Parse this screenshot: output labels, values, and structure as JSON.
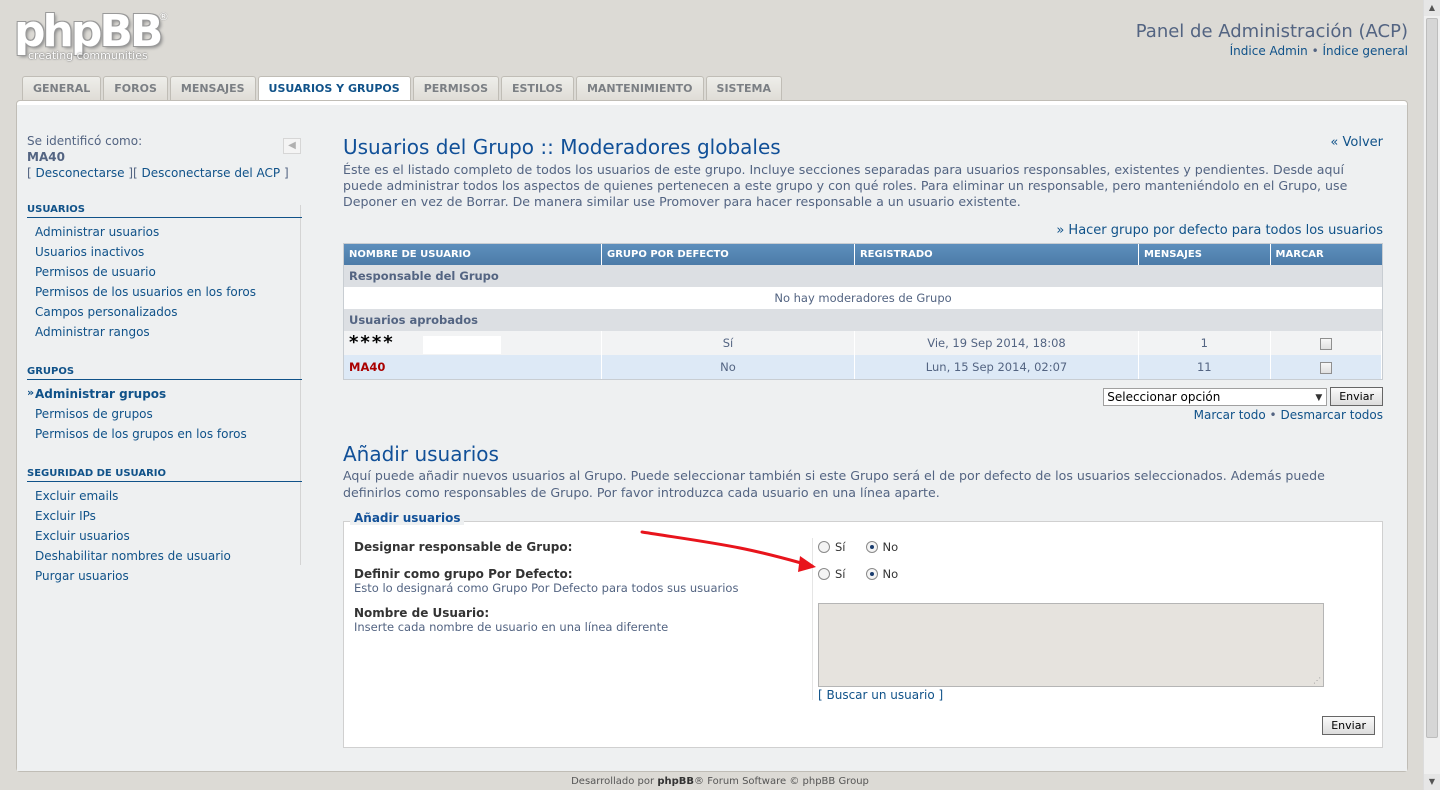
{
  "header": {
    "logo_text": "phpBB",
    "logo_reg": "®",
    "logo_tagline": "creating  communities",
    "acp_title": "Panel de Administración (ACP)",
    "link_admin_index": "Índice Admin",
    "link_separator": " • ",
    "link_general_index": "Índice general"
  },
  "tabs": [
    {
      "label": "General"
    },
    {
      "label": "Foros"
    },
    {
      "label": "Mensajes"
    },
    {
      "label": "Usuarios y Grupos",
      "active": true
    },
    {
      "label": "Permisos"
    },
    {
      "label": "Estilos"
    },
    {
      "label": "Mantenimiento"
    },
    {
      "label": "Sistema"
    }
  ],
  "sidebar": {
    "logged_label": "Se identificó como:",
    "user": "MA40",
    "logout_open": "[ ",
    "logout": "Desconectarse",
    "logout_mid": " ][ ",
    "logout_acp": "Desconectarse del ACP",
    "logout_close": " ]",
    "collapse_glyph": "◀",
    "sections": [
      {
        "title": "Usuarios",
        "items": [
          "Administrar usuarios",
          "Usuarios inactivos",
          "Permisos de usuario",
          "Permisos de los usuarios en los foros",
          "Campos personalizados",
          "Administrar rangos"
        ]
      },
      {
        "title": "Grupos",
        "items": [
          "Administrar grupos",
          "Permisos de grupos",
          "Permisos de los grupos en los foros"
        ]
      },
      {
        "title": "Seguridad de usuario",
        "items": [
          "Excluir emails",
          "Excluir IPs",
          "Excluir usuarios",
          "Deshabilitar nombres de usuario",
          "Purgar usuarios"
        ]
      }
    ]
  },
  "main": {
    "title": "Usuarios del Grupo :: Moderadores globales",
    "back": "« Volver",
    "intro": "Éste es el listado completo de todos los usuarios de este grupo. Incluye secciones separadas para usuarios responsables, existentes y pendientes. Desde aquí puede administrar todos los aspectos de quienes pertenecen a este grupo y con qué roles. Para eliminar un responsable, pero manteniéndolo en el Grupo, use Deponer en vez de Borrar. De manera similar use Promover para hacer responsable a un usuario existente.",
    "default_link": "» Hacer grupo por defecto para todos los usuarios",
    "table": {
      "headers": [
        "Nombre de usuario",
        "Grupo por defecto",
        "Registrado",
        "Mensajes",
        "Marcar"
      ],
      "leaders_label": "Responsable del Grupo",
      "no_leaders": "No hay moderadores de Grupo",
      "approved_label": "Usuarios aprobados",
      "rows": [
        {
          "name": "****",
          "default": "Sí",
          "registered": "Vie, 19 Sep 2014, 18:08",
          "posts": "1"
        },
        {
          "name": "MA40",
          "default": "No",
          "registered": "Lun, 15 Sep 2014, 02:07",
          "posts": "11"
        }
      ]
    },
    "select_value": "Seleccionar opción",
    "submit": "Enviar",
    "mark_all": "Marcar todo",
    "mark_sep": " • ",
    "unmark_all": "Desmarcar todos"
  },
  "add": {
    "title": "Añadir usuarios",
    "intro": "Aquí puede añadir nuevos usuarios al Grupo. Puede seleccionar también si este Grupo será el de por defecto de los usuarios seleccionados. Además puede definirlos como responsables de Grupo. Por favor introduzca cada usuario en una línea aparte.",
    "legend": "Añadir usuarios",
    "leader_label": "Designar responsable de Grupo:",
    "default_label": "Definir como grupo Por Defecto:",
    "default_hint": "Esto lo designará como Grupo Por Defecto para todos sus usuarios",
    "username_label": "Nombre de Usuario:",
    "username_hint": "Inserte cada nombre de usuario en una línea diferente",
    "yes": "Sí",
    "no": "No",
    "find_user": "[ Buscar un usuario ]",
    "submit": "Enviar"
  },
  "footer": {
    "prefix": "Desarrollado por ",
    "brand": "phpBB",
    "suffix": "® Forum Software © phpBB Group"
  },
  "colors": {
    "annotation_arrow": "#e8141c",
    "table_header": "#4c7ba8",
    "link": "#105289"
  }
}
